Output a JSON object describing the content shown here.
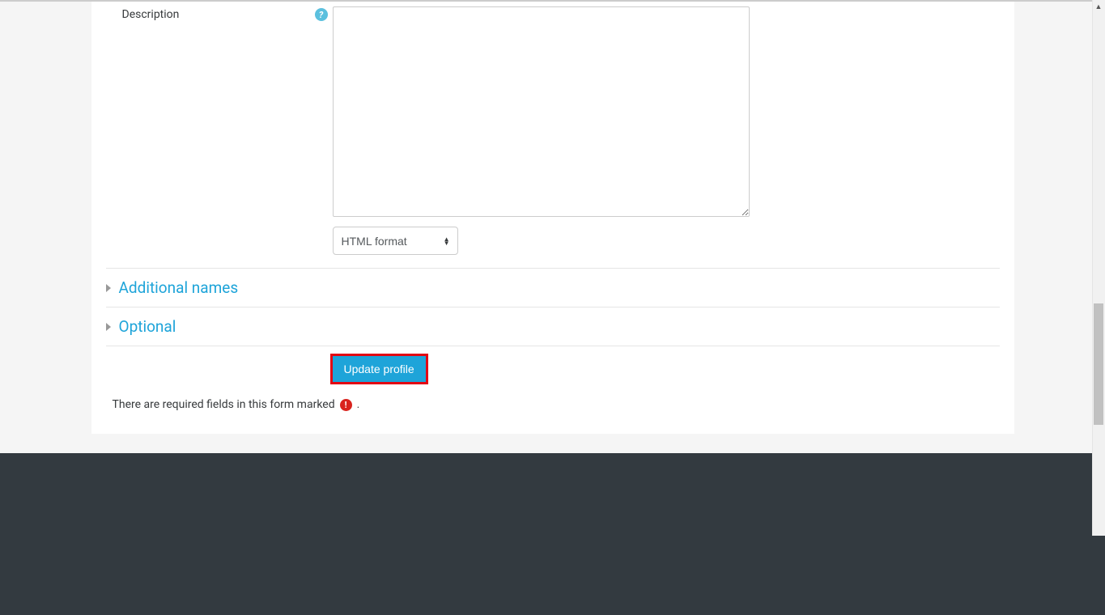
{
  "form": {
    "description_label": "Description",
    "description_value": "",
    "format_select": {
      "selected": "HTML format",
      "options": [
        "HTML format"
      ]
    }
  },
  "sections": {
    "additional_names": "Additional names",
    "optional": "Optional"
  },
  "actions": {
    "update_profile": "Update profile"
  },
  "notes": {
    "required_fields_prefix": "There are required fields in this form marked",
    "required_fields_suffix": "."
  }
}
